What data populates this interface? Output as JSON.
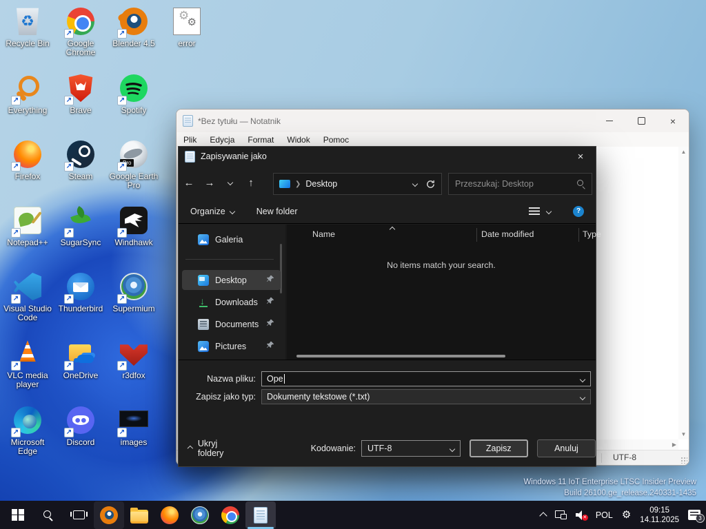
{
  "desktop": {
    "icons": [
      {
        "label": "Recycle Bin"
      },
      {
        "label": "Google Chrome"
      },
      {
        "label": "Blender 4.5"
      },
      {
        "label": "error"
      },
      {
        "label": "Everything"
      },
      {
        "label": "Brave"
      },
      {
        "label": "Spotify"
      },
      {
        "label": "Firefox"
      },
      {
        "label": "Steam"
      },
      {
        "label": "Google Earth Pro"
      },
      {
        "label": "Notepad++"
      },
      {
        "label": "SugarSync"
      },
      {
        "label": "Windhawk"
      },
      {
        "label": "Visual Studio Code"
      },
      {
        "label": "Thunderbird"
      },
      {
        "label": "Supermium"
      },
      {
        "label": "VLC media player"
      },
      {
        "label": "OneDrive"
      },
      {
        "label": "r3dfox"
      },
      {
        "label": "Microsoft Edge"
      },
      {
        "label": "Discord"
      },
      {
        "label": "images"
      }
    ],
    "system_info_line1": "Windows 11 IoT Enterprise LTSC Insider Preview",
    "system_info_line2": "Build 26100.ge_release.240331-1435"
  },
  "notepad": {
    "title": "*Bez tytułu — Notatnik",
    "menus": [
      "Plik",
      "Edycja",
      "Format",
      "Widok",
      "Pomoc"
    ],
    "status_encoding": "UTF-8"
  },
  "dialog": {
    "title": "Zapisywanie jako",
    "breadcrumb": "Desktop",
    "search_placeholder": "Przeszukaj: Desktop",
    "organize": "Organize",
    "new_folder": "New folder",
    "sidebar": [
      {
        "label": "Galeria"
      },
      {
        "label": "Desktop"
      },
      {
        "label": "Downloads"
      },
      {
        "label": "Documents"
      },
      {
        "label": "Pictures"
      }
    ],
    "columns": {
      "name": "Name",
      "date": "Date modified",
      "type": "Type"
    },
    "empty_message": "No items match your search.",
    "filename_label": "Nazwa pliku:",
    "filename_value": "Ope",
    "filetype_label": "Zapisz jako typ:",
    "filetype_value": "Dokumenty tekstowe (*.txt)",
    "hide_folders": "Ukryj foldery",
    "encoding_label": "Kodowanie:",
    "encoding_value": "UTF-8",
    "save": "Zapisz",
    "cancel": "Anuluj"
  },
  "taskbar": {
    "language": "POL",
    "time": "09:15",
    "date": "14.11.2025",
    "notification_count": "3"
  },
  "colors": {
    "accent": "#7fc7ef",
    "dialog_bg": "#1e1e1e",
    "taskbar_bg": "#14141d",
    "selection": "#3a3a3a"
  }
}
